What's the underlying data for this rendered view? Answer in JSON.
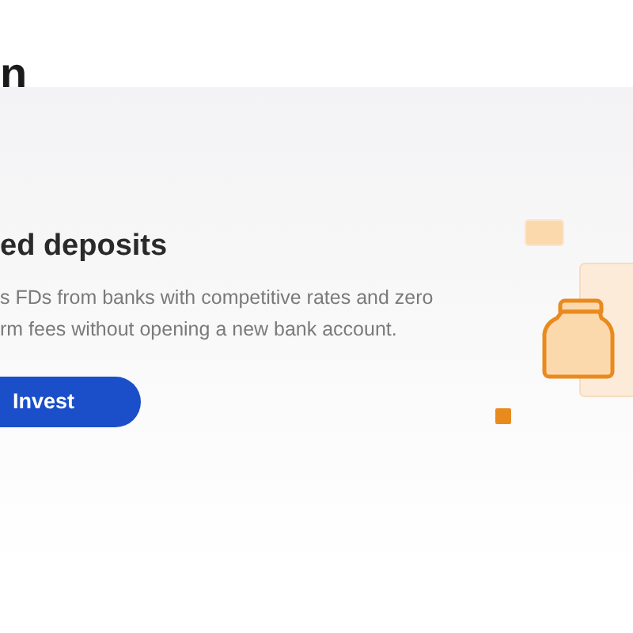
{
  "page_title": "n",
  "hero": {
    "title": "ed deposits",
    "description_lines": [
      "s FDs from banks with competitive rates and zero",
      "rm fees without opening a new bank account."
    ],
    "button": "Invest"
  }
}
